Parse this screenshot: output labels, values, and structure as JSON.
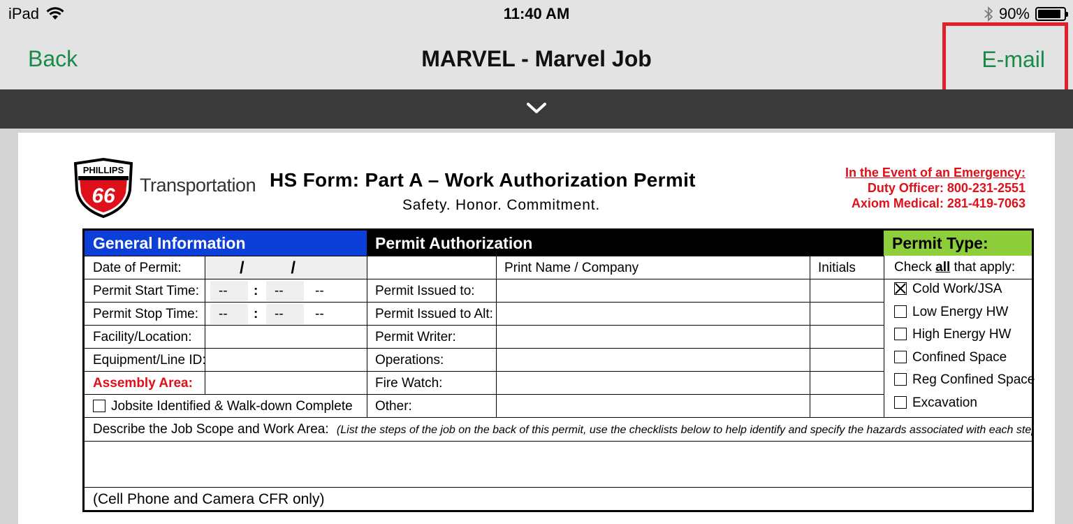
{
  "status_bar": {
    "device": "iPad",
    "time": "11:40 AM",
    "battery": "90%",
    "battery_level": 0.9
  },
  "nav": {
    "back_label": "Back",
    "title": "MARVEL - Marvel Job",
    "email_label": "E-mail"
  },
  "drawer": {
    "icon": "chevron-down-icon"
  },
  "document": {
    "logo_text": "PHILLIPS",
    "logo_number": "66",
    "brand": "Transportation",
    "title": "HS Form: Part A – Work Authorization Permit",
    "subtitle": "Safety.  Honor.  Commitment.",
    "emergency": {
      "heading": "In the Event of an Emergency:",
      "duty_officer": "Duty Officer: 800-231-2551",
      "axiom": "Axiom Medical: 281-419-7063"
    },
    "form": {
      "headers": {
        "general": "General Information",
        "authorization": "Permit Authorization",
        "type": "Permit Type:"
      },
      "general_rows": [
        {
          "label": "Date of Permit:",
          "value": "/          /"
        },
        {
          "label": "Permit Start Time:",
          "hh": "--",
          "sep": ":",
          "mm": "--",
          "ampm": "--"
        },
        {
          "label": "Permit Stop Time:",
          "hh": "--",
          "sep": ":",
          "mm": "--",
          "ampm": "--"
        },
        {
          "label": "Facility/Location:"
        },
        {
          "label": "Equipment/Line ID:"
        },
        {
          "label": "Assembly Area:"
        },
        {
          "label": "Jobsite Identified & Walk-down Complete"
        }
      ],
      "auth_header": {
        "name_company": "Print Name / Company",
        "initials": "Initials"
      },
      "auth_rows": [
        "Permit Issued to:",
        "Permit Issued to Alt:",
        "Permit Writer:",
        "Operations:",
        "Fire Watch:",
        "Other:"
      ],
      "permit_type": {
        "check_prefix": "Check ",
        "check_all": "all",
        "check_suffix": " that apply:",
        "items": [
          {
            "label": "Cold Work/JSA",
            "checked": true
          },
          {
            "label": "Low Energy HW",
            "checked": false
          },
          {
            "label": "High Energy HW",
            "checked": false
          },
          {
            "label": "Confined Space",
            "checked": false
          },
          {
            "label": "Reg Confined Space",
            "checked": false
          },
          {
            "label": "Excavation",
            "checked": false
          }
        ]
      },
      "describe_label": "Describe the Job Scope and Work Area:",
      "describe_hint": "(List the steps of the job on the back of this permit, use the checklists below to help identify and specify the hazards associated with each step)",
      "footer_note": "(Cell Phone and Camera CFR only)"
    }
  }
}
